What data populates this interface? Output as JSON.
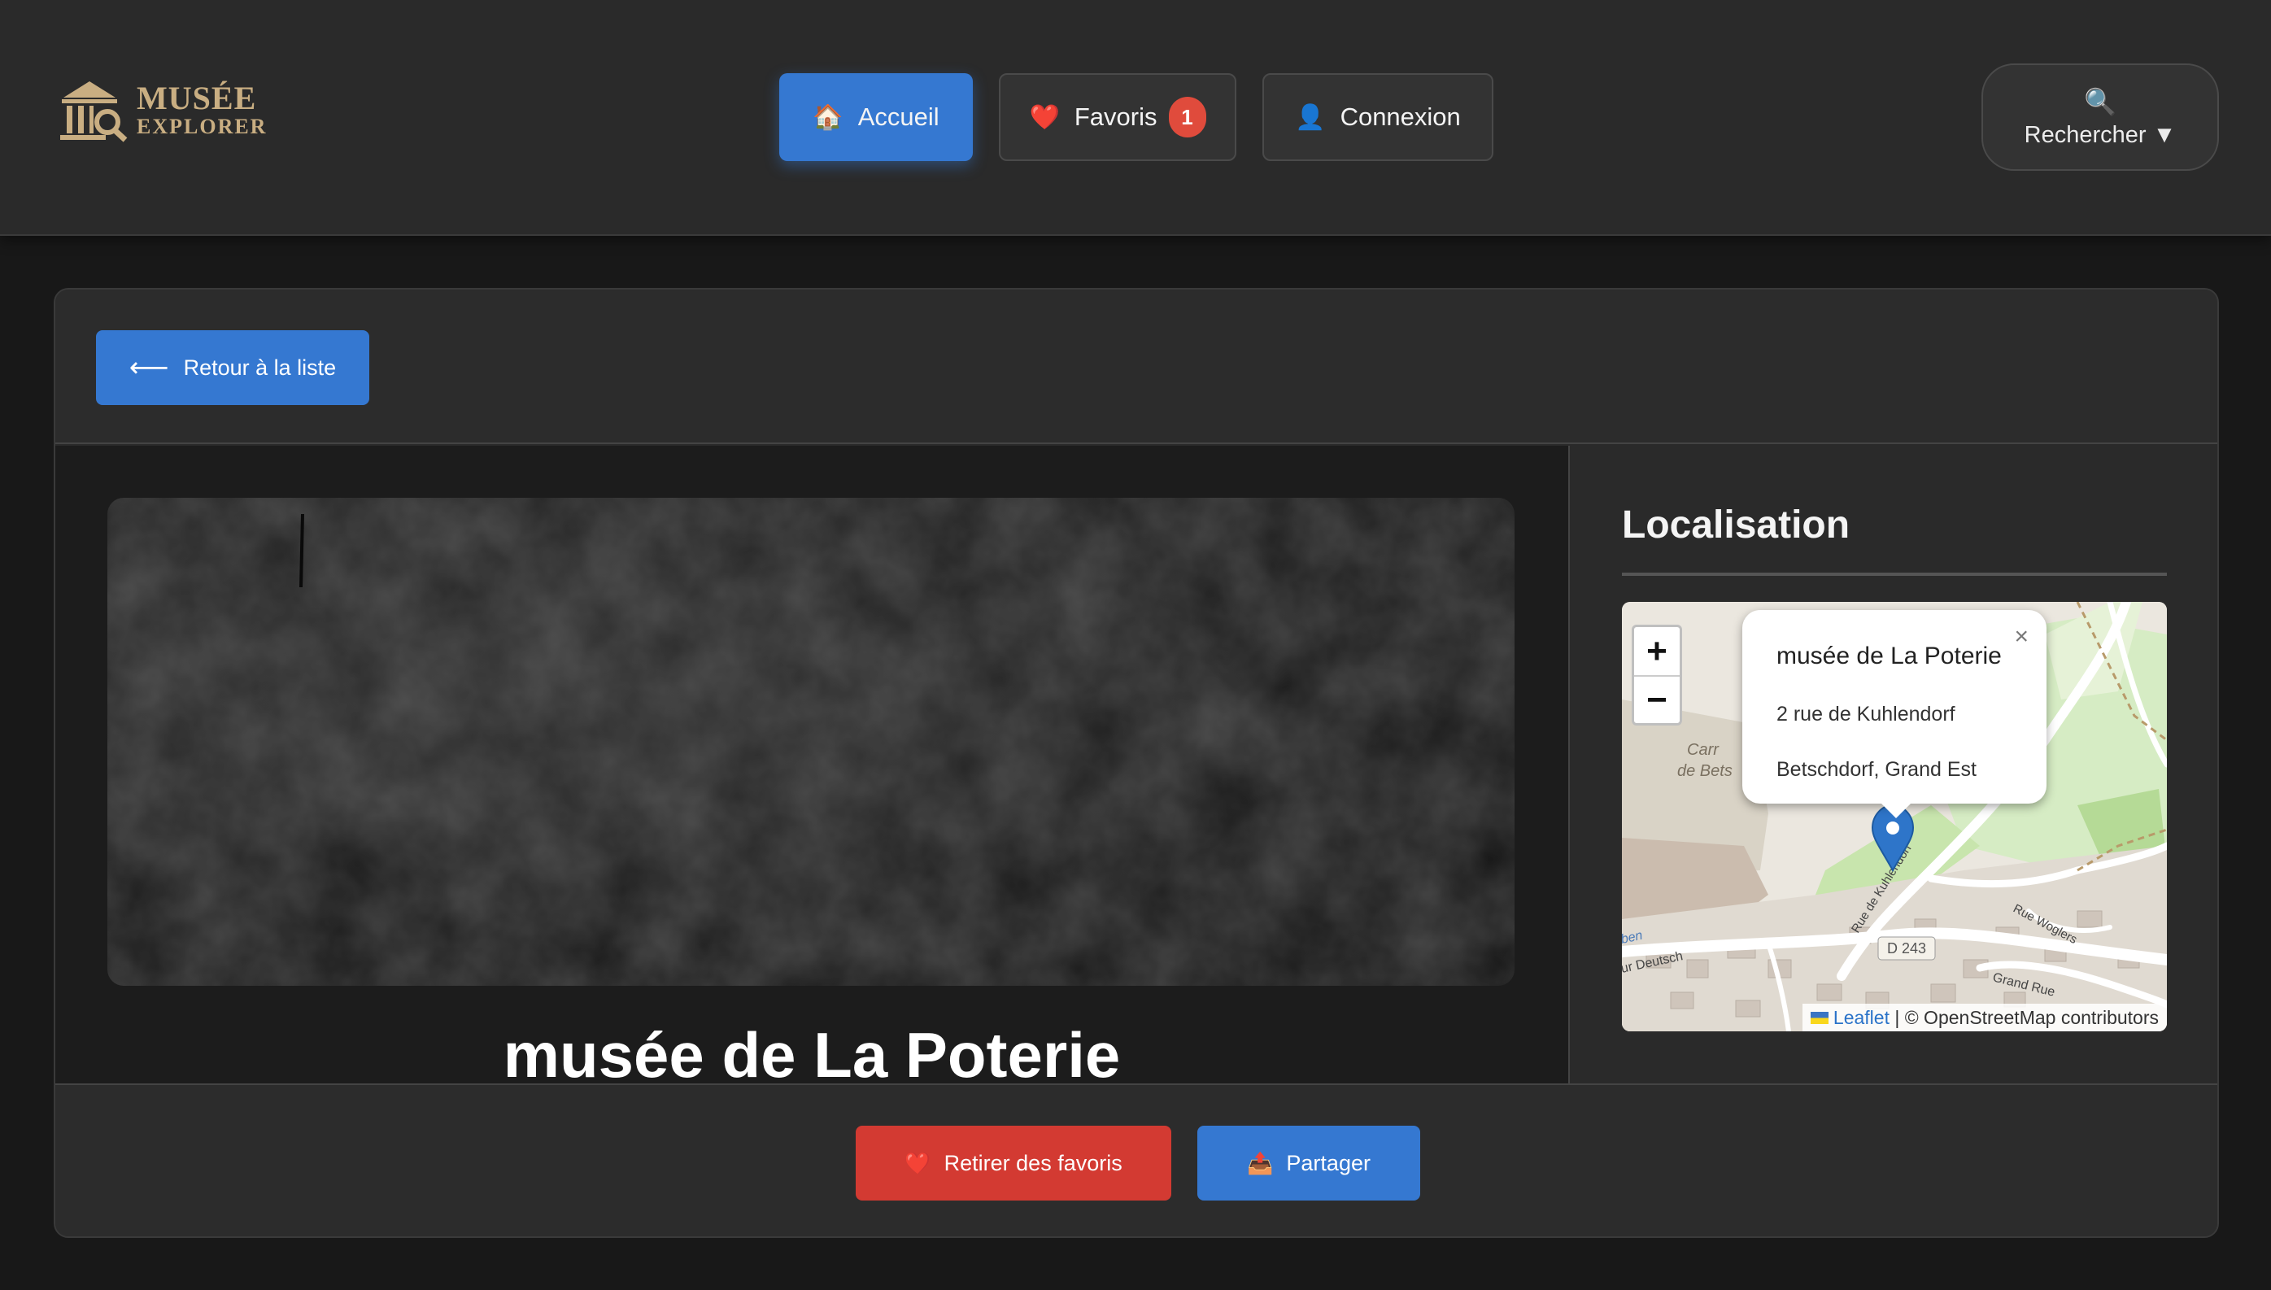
{
  "header": {
    "logo": {
      "line1": "MUSÉE",
      "line2": "EXPLORER",
      "icon": "museum-magnifier-icon"
    },
    "nav": [
      {
        "label": "Accueil",
        "icon": "🏠",
        "active": true
      },
      {
        "label": "Favoris",
        "icon": "❤️",
        "badge": "1"
      },
      {
        "label": "Connexion",
        "icon": "👤"
      }
    ],
    "search": {
      "icon": "🔍",
      "label": "Rechercher ▼"
    }
  },
  "detail": {
    "back_label": "Retour à la liste",
    "back_icon": "⟵",
    "title": "musée de La Poterie"
  },
  "location": {
    "heading": "Localisation",
    "popup": {
      "title": "musée de La Poterie",
      "address": "2 rue de Kuhlendorf",
      "city": "Betschdorf, Grand Est",
      "close": "×"
    },
    "zoom_in": "+",
    "zoom_out": "−",
    "map_labels": {
      "road_d243": "D 243",
      "rue_deutsch": "ur Deutsch",
      "rue_kuhlendorf": "Rue de Kuhlendorf",
      "rue_woglers": "Rue Woglers",
      "grand_rue": "Grand Rue",
      "carriere_line1": "Carr",
      "carriere_line2": "de Bets",
      "ben": "ben"
    },
    "attribution": {
      "leaflet": "Leaflet",
      "osm": "| © OpenStreetMap contributors"
    }
  },
  "actions": {
    "remove_label": "Retirer des favoris",
    "remove_icon": "❤️",
    "share_label": "Partager",
    "share_icon": "📤"
  },
  "colors": {
    "primary": "#3578d1",
    "danger": "#d33a32",
    "badge": "#e04b3c",
    "logo": "#c9ae82",
    "background": "#181818",
    "surface": "#2a2a2a"
  }
}
